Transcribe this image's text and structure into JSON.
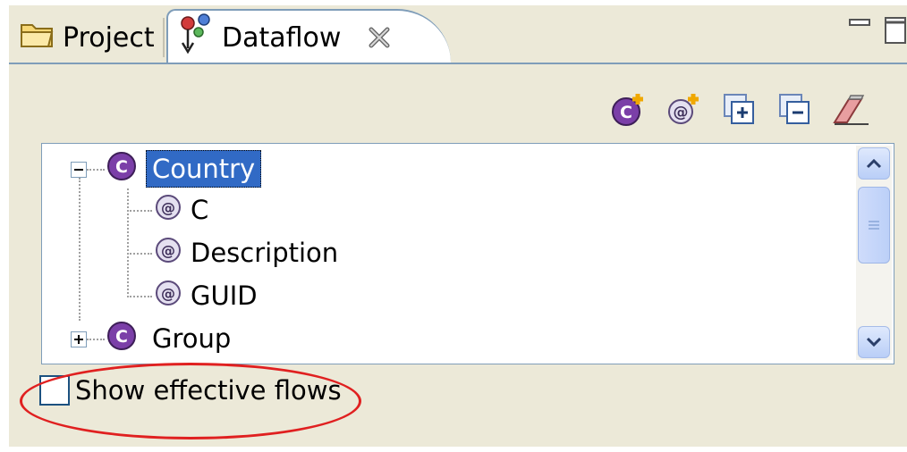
{
  "tabs": [
    {
      "label": "Project",
      "icon": "folder-icon",
      "active": false
    },
    {
      "label": "Dataflow",
      "icon": "dataflow-icon",
      "active": true
    }
  ],
  "window_controls": [
    "minimize-icon",
    "maximize-icon"
  ],
  "toolbar": {
    "buttons": [
      {
        "name": "add-class-button",
        "icon": "class-add-icon"
      },
      {
        "name": "add-attribute-button",
        "icon": "attribute-add-icon"
      },
      {
        "name": "expand-all-button",
        "icon": "expand-all-icon"
      },
      {
        "name": "collapse-all-button",
        "icon": "collapse-all-icon"
      },
      {
        "name": "clear-button",
        "icon": "eraser-icon"
      }
    ]
  },
  "tree": {
    "items": [
      {
        "label": "Country",
        "kind": "class",
        "expanded": true,
        "selected": true,
        "children": [
          {
            "label": "C",
            "kind": "attribute"
          },
          {
            "label": "Description",
            "kind": "attribute"
          },
          {
            "label": "GUID",
            "kind": "attribute"
          }
        ]
      },
      {
        "label": "Group",
        "kind": "class",
        "expanded": false,
        "selected": false,
        "children": []
      }
    ]
  },
  "options": {
    "show_effective_flows": {
      "label": "Show effective flows",
      "checked": false
    }
  },
  "colors": {
    "selection": "#316ac5",
    "class_icon": "#7b3fa8",
    "highlight_ellipse": "#e02020",
    "panel_bg": "#ece9d8"
  }
}
